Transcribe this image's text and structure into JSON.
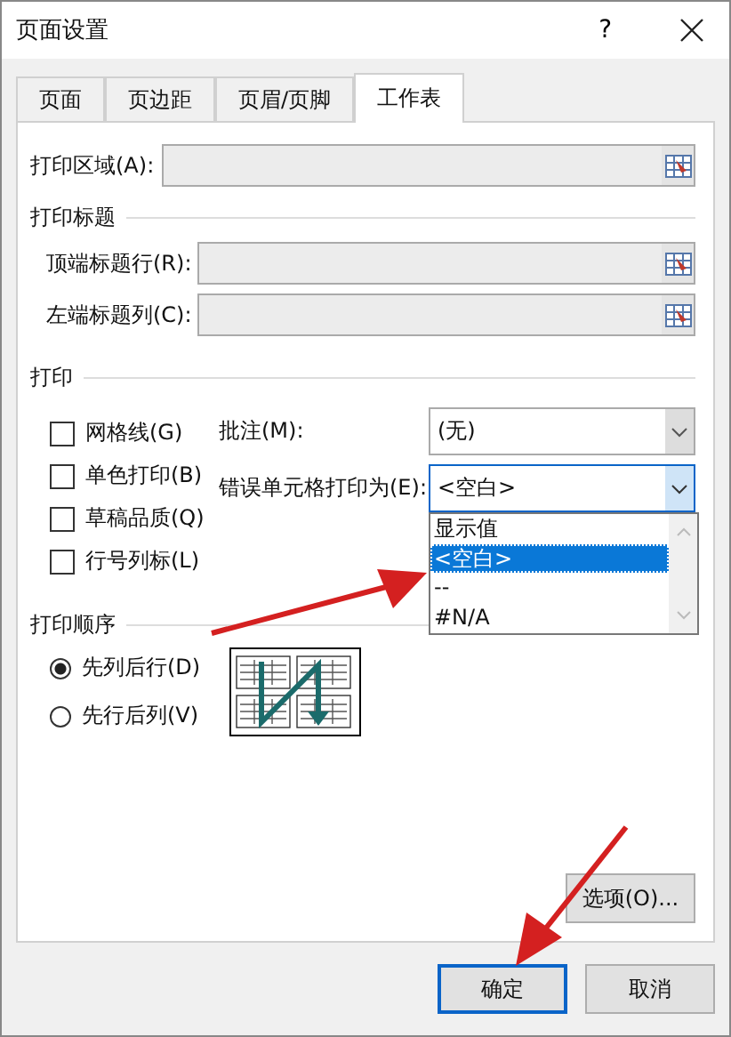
{
  "window": {
    "title": "页面设置",
    "help": "?"
  },
  "tabs": [
    {
      "label": "页面",
      "selected": false
    },
    {
      "label": "页边距",
      "selected": false
    },
    {
      "label": "页眉/页脚",
      "selected": false
    },
    {
      "label": "工作表",
      "selected": true
    }
  ],
  "print_area": {
    "label": "打印区域(A):"
  },
  "print_titles": {
    "heading": "打印标题",
    "rows": [
      {
        "label": "顶端标题行(R):"
      },
      {
        "label": "左端标题列(C):"
      }
    ]
  },
  "print": {
    "heading": "打印",
    "checkboxes": [
      {
        "label": "网格线(G)",
        "checked": false
      },
      {
        "label": "单色打印(B)",
        "checked": false
      },
      {
        "label": "草稿品质(Q)",
        "checked": false
      },
      {
        "label": "行号列标(L)",
        "checked": false
      }
    ],
    "comments": {
      "label": "批注(M):",
      "value": "(无)"
    },
    "errors": {
      "label": "错误单元格打印为(E):",
      "value": "<空白>",
      "options": [
        {
          "label": "显示值",
          "selected": false
        },
        {
          "label": "<空白>",
          "selected": true
        },
        {
          "label": "--",
          "selected": false
        },
        {
          "label": "#N/A",
          "selected": false
        }
      ]
    }
  },
  "print_order": {
    "heading": "打印顺序",
    "options": [
      {
        "label": "先列后行(D)",
        "selected": true
      },
      {
        "label": "先行后列(V)",
        "selected": false
      }
    ]
  },
  "options_button": "选项(O)...",
  "ok_button": "确定",
  "cancel_button": "取消"
}
